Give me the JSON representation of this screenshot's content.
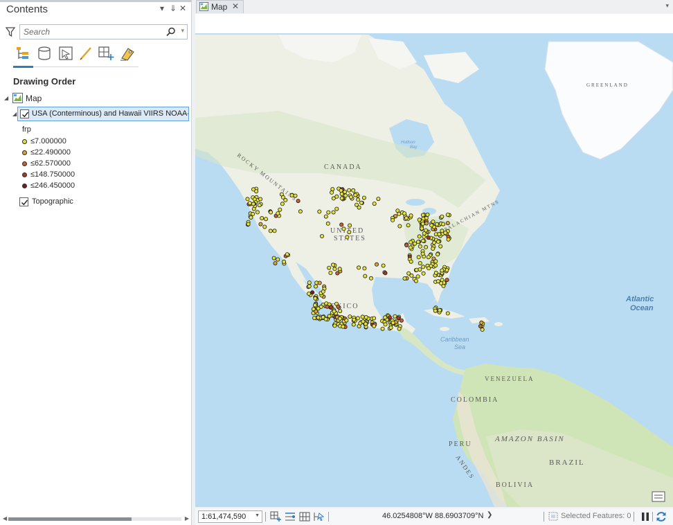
{
  "contents_pane": {
    "title": "Contents",
    "controls": [
      "▾",
      "⇓",
      "✕"
    ],
    "search": {
      "placeholder": "Search",
      "value": ""
    },
    "toolbar": [
      "list-by-drawing-order-icon",
      "list-by-data-source-icon",
      "list-by-selection-icon",
      "list-by-editing-icon",
      "list-by-snapping-icon",
      "list-by-labeling-icon"
    ],
    "section_title": "Drawing Order",
    "map_node": {
      "label": "Map"
    },
    "layer": {
      "label": "USA (Conterminous) and Hawaii VIIRS NOAA-",
      "checked": true,
      "field": "frp",
      "classes": [
        {
          "label": "≤7.000000",
          "color": "#e3e33c"
        },
        {
          "label": "≤22.490000",
          "color": "#d9a23a"
        },
        {
          "label": "≤62.570000",
          "color": "#c8612f"
        },
        {
          "label": "≤148.750000",
          "color": "#a8382a"
        },
        {
          "label": "≤246.450000",
          "color": "#7a1f1f"
        }
      ]
    },
    "basemap": {
      "label": "Topographic",
      "checked": true
    }
  },
  "map_view": {
    "tab_label": "Map",
    "tab_close": "✕",
    "tab_menu": "▾",
    "labels": {
      "canada": "CANADA",
      "usa_1": "UNITED",
      "usa_2": "STATES",
      "mexico": "MEXICO",
      "rocky": "ROCKY MOUNTAINS",
      "appalachian": "APPALACHIAN MTNS",
      "atlantic_1": "Atlantic",
      "atlantic_2": "Ocean",
      "caribbean_1": "Caribbean",
      "caribbean_2": "Sea",
      "venezuela": "VENEZUELA",
      "colombia": "COLOMBIA",
      "peru": "PERU",
      "amazon": "AMAZON BASIN",
      "brazil": "BRAZIL",
      "bolivia": "BOLIVIA",
      "andes": "ANDES",
      "greenland": "GREENLAND",
      "hudson_1": "Hudson",
      "hudson_2": "Bay"
    },
    "colors": {
      "ocean": "#b9dcf2",
      "land": "#eef0e6",
      "ice": "#fbfcfd",
      "vegetation": "#d7e6c4",
      "amazon": "#cfe4b7"
    }
  },
  "status_bar": {
    "scale": "1:61,474,590",
    "coordinates": "46.0254808°W 88.6903709°N",
    "selected_features": "Selected Features: 0"
  }
}
